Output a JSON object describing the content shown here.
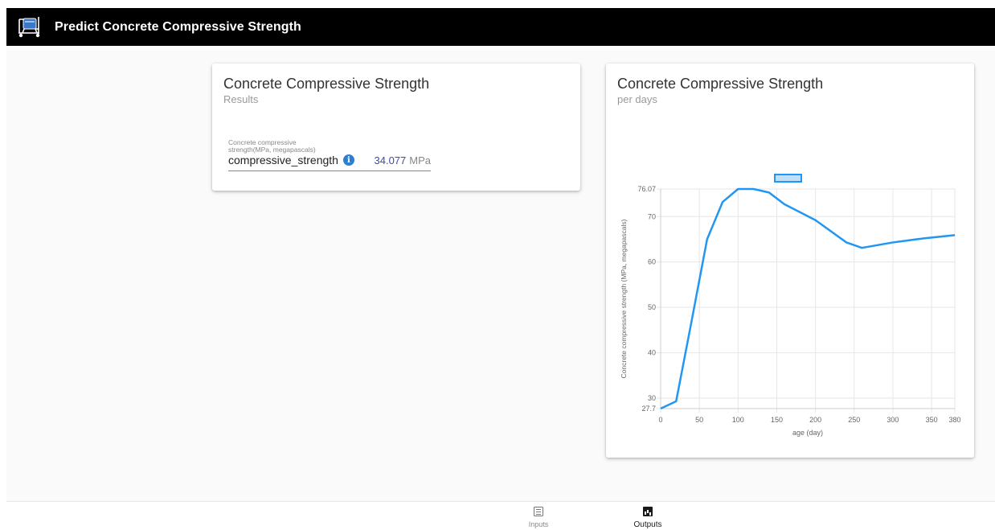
{
  "app": {
    "title": "Predict Concrete Compressive Strength",
    "logo_icon": "concrete-mixer-icon"
  },
  "result_card": {
    "title": "Concrete Compressive Strength",
    "subtitle": "Results",
    "field": {
      "label": "Concrete compressive strength(MPa, megapascals)",
      "name": "compressive_strength",
      "info_icon": "info-icon",
      "value": "34.077",
      "unit": "MPa"
    }
  },
  "chart_card": {
    "title": "Concrete Compressive Strength",
    "subtitle": "per days"
  },
  "chart_data": {
    "type": "line",
    "series": [
      {
        "color": "#2196f3",
        "x": [
          0,
          20,
          40,
          60,
          80,
          100,
          120,
          140,
          160,
          200,
          240,
          260,
          300,
          340,
          380
        ],
        "y": [
          27.7,
          29.3,
          47,
          65,
          73.2,
          76.07,
          76.07,
          75.3,
          72.7,
          69.2,
          64.3,
          63.1,
          64.3,
          65.2,
          65.9
        ]
      }
    ],
    "xlabel": "age (day)",
    "ylabel": "Concrete compressive strength (MPa, megapascals)",
    "xlim": [
      0,
      380
    ],
    "ylim": [
      27.7,
      76.07
    ],
    "xticks": [
      0,
      50,
      100,
      150,
      200,
      250,
      300,
      350,
      380
    ],
    "yticks": [
      27.7,
      30,
      40,
      50,
      60,
      70,
      76.07
    ],
    "grid": true,
    "legend": "top-center"
  },
  "bottom_nav": {
    "inputs_label": "Inputs",
    "outputs_label": "Outputs"
  }
}
